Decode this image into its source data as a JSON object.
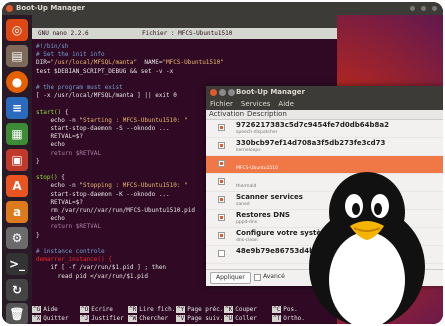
{
  "topbar": {
    "title": "Boot-Up Manager"
  },
  "terminal": {
    "nano_left": "GNU nano 2.2.6",
    "nano_file": "Fichier : MFCS-Ubuntu1510",
    "path_line": "\"/usr/local/MFSQL/manta\"",
    "name_line": "\"MFCS-Ubuntu1510\"",
    "start_echo": "Starting : MFCS-Ubuntu1510: \"",
    "stop_echo": "Stopping : MFCS-Ubuntu1510: \"",
    "pid_line": "/var/run/MFCS-Ubuntu1510.pid",
    "footer_row1": [
      "Aide",
      "Ecrire",
      "Lire fich.",
      "Page préc.",
      "Couper",
      "Pos."
    ],
    "footer_row2": [
      "Quitter",
      "Justifier",
      "Chercher",
      "Page suiv.",
      "Coller",
      "Ortho."
    ],
    "footer_keys1": [
      "^G",
      "^O",
      "^R",
      "^Y",
      "^K",
      "^C"
    ],
    "footer_keys2": [
      "^X",
      "^J",
      "^W",
      "^V",
      "^U",
      "^T"
    ]
  },
  "bum": {
    "title": "Boot-Up Manager",
    "menu": [
      "Fichier",
      "Services",
      "Aide"
    ],
    "columns": [
      "Activation",
      "Description"
    ],
    "services": [
      {
        "name": "9726217383c5d7c9454fe7d0db64b8a2",
        "sub": "speech-dispatcher",
        "checked": true,
        "selected": false
      },
      {
        "name": "330bcb97ef14d708a3f5db273fe3cd73",
        "sub": "kerneloops",
        "checked": true,
        "selected": false
      },
      {
        "name": "",
        "sub": "MFCS-Ubuntu1510",
        "checked": true,
        "selected": true
      },
      {
        "name": "",
        "sub": "thermald",
        "checked": true,
        "selected": false
      },
      {
        "name": "Scanner services",
        "sub": "saned",
        "checked": true,
        "selected": false
      },
      {
        "name": "Restores DNS",
        "sub": "pppd-dns",
        "checked": true,
        "selected": false
      },
      {
        "name": "Configure votre système pour les",
        "sub": "dns-clean",
        "checked": true,
        "selected": false
      },
      {
        "name": "48e9b79e86753d4ba579",
        "sub": "",
        "checked": false,
        "selected": false
      }
    ],
    "apply_label": "Appliquer",
    "advanced_label": "Avancé"
  },
  "launcher": {
    "icons": [
      "ubuntu-dash-icon",
      "files-icon",
      "firefox-icon",
      "writer-icon",
      "calc-icon",
      "impress-icon",
      "software-center-icon",
      "amazon-icon",
      "settings-icon",
      "terminal-icon",
      "update-icon",
      "trash-icon"
    ]
  }
}
